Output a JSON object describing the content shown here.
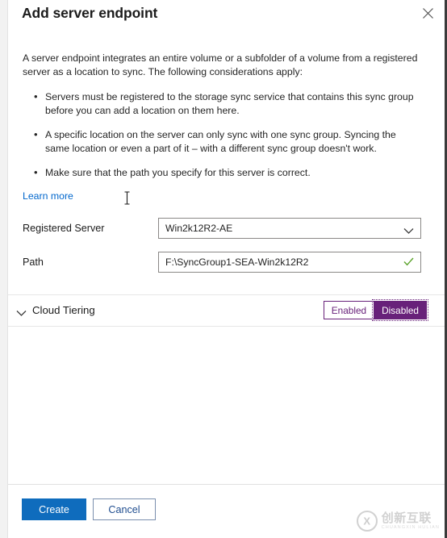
{
  "blade": {
    "title": "Add server endpoint",
    "close_icon": "close-icon"
  },
  "body": {
    "intro": "A server endpoint integrates an entire volume or a subfolder of a volume from a registered server as a location to sync. The following considerations apply:",
    "considerations": [
      "Servers must be registered to the storage sync service that contains this sync group before you can add a location on them here.",
      "A specific location on the server can only sync with one sync group. Syncing the same location or even a part of it – with a different sync group doesn't work.",
      "Make sure that the path you specify for this server is correct."
    ],
    "learn_more": "Learn more"
  },
  "form": {
    "registered_server": {
      "label": "Registered Server",
      "value": "Win2k12R2-AE",
      "icon": "chevron-down-icon"
    },
    "path": {
      "label": "Path",
      "value": "F:\\SyncGroup1-SEA-Win2k12R2",
      "icon": "checkmark-icon",
      "valid_color": "#5ba32b"
    }
  },
  "cloud_tiering": {
    "title": "Cloud Tiering",
    "expand_icon": "chevron-down-icon",
    "options": [
      {
        "label": "Enabled",
        "selected": false
      },
      {
        "label": "Disabled",
        "selected": true
      }
    ],
    "accent_color": "#68217a"
  },
  "footer": {
    "create_label": "Create",
    "cancel_label": "Cancel",
    "create_color": "#0f6cbd"
  },
  "watermark": {
    "mark": "CX",
    "name": "创新互联",
    "pinyin": "CHUANGXIN HULIAN"
  }
}
